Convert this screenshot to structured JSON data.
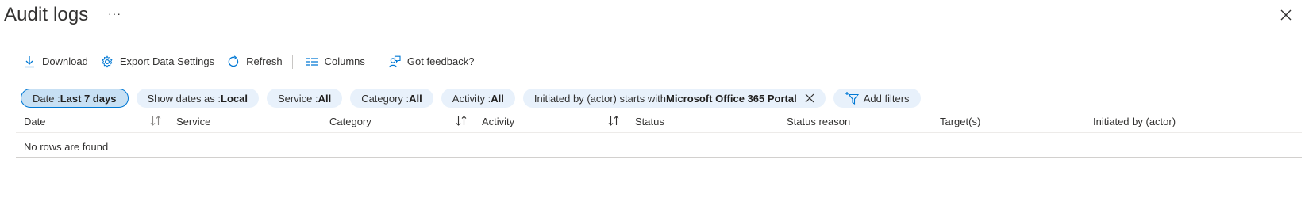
{
  "header": {
    "title": "Audit logs",
    "more": "···"
  },
  "toolbar": {
    "download": "Download",
    "export": "Export Data Settings",
    "refresh": "Refresh",
    "columns": "Columns",
    "feedback": "Got feedback?"
  },
  "filters": {
    "date": {
      "key": "Date : ",
      "value": "Last 7 days"
    },
    "show_dates": {
      "key": "Show dates as : ",
      "value": "Local"
    },
    "service": {
      "key": "Service : ",
      "value": "All"
    },
    "category": {
      "key": "Category : ",
      "value": "All"
    },
    "activity": {
      "key": "Activity : ",
      "value": "All"
    },
    "initiated": {
      "key": "Initiated by (actor) starts with ",
      "value": "Microsoft Office 365 Portal"
    },
    "add": "Add filters"
  },
  "table": {
    "columns": [
      "Date",
      "Service",
      "Category",
      "Activity",
      "Status",
      "Status reason",
      "Target(s)",
      "Initiated by (actor)"
    ],
    "empty_message": "No rows are found"
  },
  "colors": {
    "accent": "#0078d4",
    "pill_bg": "#e8f1fb",
    "pill_active_bg": "#c7e0f4",
    "text": "#323130"
  }
}
